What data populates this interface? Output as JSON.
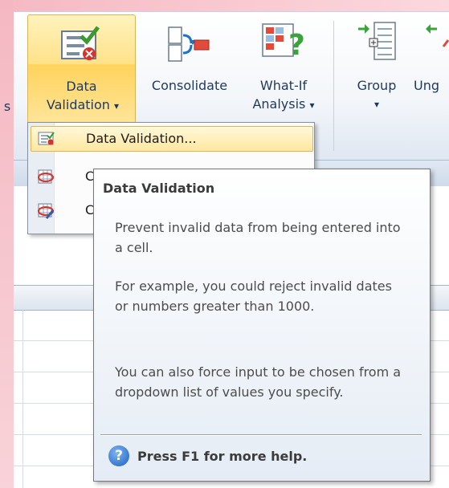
{
  "ribbon": {
    "left_cut_label": "s",
    "buttons": [
      {
        "line1": "Data",
        "line2": "Validation",
        "dropdown": "▾"
      },
      {
        "line1": "Consolidate",
        "line2": ""
      },
      {
        "line1": "What-If",
        "line2": "Analysis",
        "dropdown": "▾"
      },
      {
        "line1": "Group",
        "dropdown": "▾"
      },
      {
        "line1": "Ung"
      }
    ]
  },
  "menu": {
    "items": [
      {
        "label": "Data Validation...",
        "icon": "data-validation-icon"
      },
      {
        "label": "C",
        "icon": "circle-invalid-data-icon"
      },
      {
        "label": "C",
        "icon": "clear-validation-circles-icon"
      }
    ]
  },
  "tooltip": {
    "title": "Data Validation",
    "para1": "Prevent invalid data from being entered into a cell.",
    "para2": "For example, you could reject invalid dates or numbers greater than 1000.",
    "para3": "You can also force input to be chosen from a dropdown list of values you specify.",
    "help": "Press F1 for more help.",
    "help_icon": "?"
  },
  "colors": {
    "highlight": "#ffe28a",
    "accent": "#1e395b",
    "pink_edge": "#f5b8c2"
  }
}
